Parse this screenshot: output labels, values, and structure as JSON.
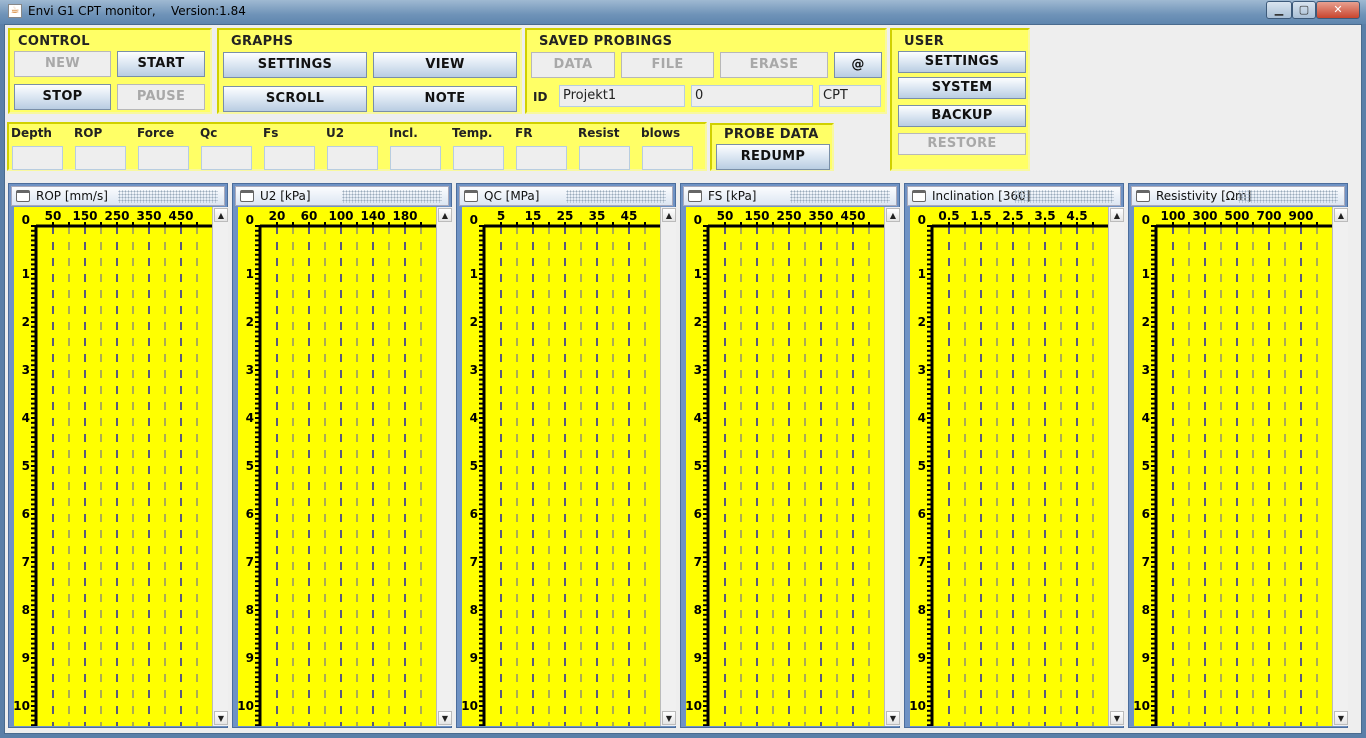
{
  "window": {
    "title": "Envi G1 CPT monitor,    Version:1.84",
    "icon": "java-icon",
    "controls": [
      "minimize",
      "maximize",
      "close"
    ]
  },
  "control": {
    "title": "CONTROL",
    "new": "NEW",
    "start": "START",
    "stop": "STOP",
    "pause": "PAUSE"
  },
  "graphs": {
    "title": "GRAPHS",
    "settings": "SETTINGS",
    "view": "VIEW",
    "scroll": "SCROLL",
    "note": "NOTE"
  },
  "saved": {
    "title": "SAVED PROBINGS",
    "data": "DATA",
    "file": "FILE",
    "erase": "ERASE",
    "at": "@",
    "id_label": "ID",
    "id_value": "Projekt1",
    "number_value": "0",
    "type_value": "CPT"
  },
  "user": {
    "title": "USER",
    "settings": "SETTINGS",
    "system": "SYSTEM",
    "backup": "BACKUP",
    "restore": "RESTORE"
  },
  "readouts": [
    {
      "label": "Depth",
      "value": ""
    },
    {
      "label": "ROP",
      "value": ""
    },
    {
      "label": "Force",
      "value": ""
    },
    {
      "label": "Qc",
      "value": ""
    },
    {
      "label": "Fs",
      "value": ""
    },
    {
      "label": "U2",
      "value": ""
    },
    {
      "label": "Incl.",
      "value": ""
    },
    {
      "label": "Temp.",
      "value": ""
    },
    {
      "label": "FR",
      "value": ""
    },
    {
      "label": "Resist",
      "value": ""
    },
    {
      "label": "blows",
      "value": ""
    }
  ],
  "probe": {
    "title": "PROBE DATA",
    "redump": "REDUMP"
  },
  "colors": {
    "panel_bg": "#ffff66",
    "plot_bg": "#ffff00",
    "major_grid": "#0000c0",
    "minor_grid": "#808080"
  },
  "chart_data": [
    {
      "type": "line",
      "title": "ROP [mm/s]",
      "xticks": [
        "50",
        "150",
        "250",
        "350",
        "450"
      ],
      "yticks": [
        "0",
        "1",
        "2",
        "3",
        "4",
        "5",
        "6",
        "7",
        "8",
        "9",
        "10"
      ],
      "series": []
    },
    {
      "type": "line",
      "title": "U2 [kPa]",
      "xticks": [
        "20",
        "60",
        "100",
        "140",
        "180"
      ],
      "yticks": [
        "0",
        "1",
        "2",
        "3",
        "4",
        "5",
        "6",
        "7",
        "8",
        "9",
        "10"
      ],
      "series": []
    },
    {
      "type": "line",
      "title": "QC [MPa]",
      "xticks": [
        "5",
        "15",
        "25",
        "35",
        "45"
      ],
      "yticks": [
        "0",
        "1",
        "2",
        "3",
        "4",
        "5",
        "6",
        "7",
        "8",
        "9",
        "10"
      ],
      "series": []
    },
    {
      "type": "line",
      "title": "FS [kPa]",
      "xticks": [
        "50",
        "150",
        "250",
        "350",
        "450"
      ],
      "yticks": [
        "0",
        "1",
        "2",
        "3",
        "4",
        "5",
        "6",
        "7",
        "8",
        "9",
        "10"
      ],
      "series": []
    },
    {
      "type": "line",
      "title": "Inclination [360]",
      "xticks": [
        "0.5",
        "1.5",
        "2.5",
        "3.5",
        "4.5"
      ],
      "yticks": [
        "0",
        "1",
        "2",
        "3",
        "4",
        "5",
        "6",
        "7",
        "8",
        "9",
        "10"
      ],
      "series": []
    },
    {
      "type": "line",
      "title": "Resistivity [Ωm]",
      "xticks": [
        "100",
        "300",
        "500",
        "700",
        "900"
      ],
      "yticks": [
        "0",
        "1",
        "2",
        "3",
        "4",
        "5",
        "6",
        "7",
        "8",
        "9",
        "10"
      ],
      "series": []
    }
  ]
}
